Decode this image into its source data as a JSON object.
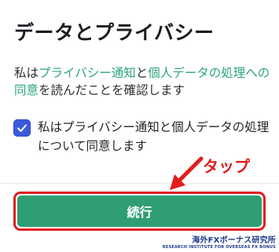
{
  "title": "データとプライバシー",
  "consent": {
    "prefix": "私は",
    "privacy_link": "プライバシー通知",
    "connector": "と",
    "data_link": "個人データの処理への同意",
    "suffix": "を読んだことを確認します"
  },
  "checkbox": {
    "checked": true,
    "label": "私はプライバシー通知と個人データの処理について同意します"
  },
  "continue_button": {
    "label": "続行"
  },
  "annotation": {
    "tap_label": "タップ",
    "color": "#e11d1d"
  },
  "colors": {
    "accent_green": "#2f9e74",
    "link_green": "#2aa57a",
    "checkbox_blue": "#3b5bdb"
  },
  "watermark": {
    "main": "海外FXボーナス研究所",
    "sub": "RESEARCH INSTITUTE FOR OVERSEAS FX BONUS"
  }
}
